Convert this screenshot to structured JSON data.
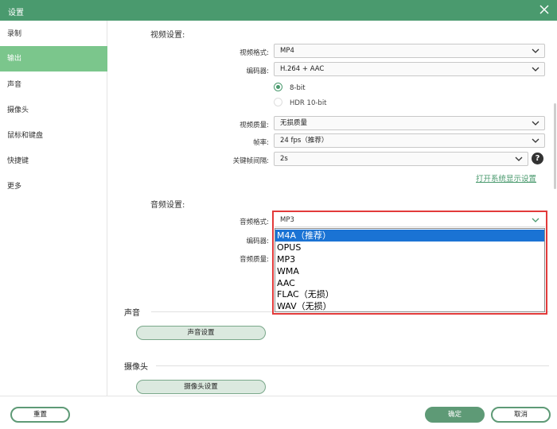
{
  "window": {
    "title": "设置",
    "close_icon": "close-icon"
  },
  "sidebar": {
    "items": [
      {
        "label": "录制",
        "active": false
      },
      {
        "label": "输出",
        "active": true
      },
      {
        "label": "声音",
        "active": false
      },
      {
        "label": "摄像头",
        "active": false
      },
      {
        "label": "鼠标和键盘",
        "active": false
      },
      {
        "label": "快捷键",
        "active": false
      },
      {
        "label": "更多",
        "active": false
      }
    ]
  },
  "video": {
    "section_title": "视频设置:",
    "format_label": "视频格式:",
    "format_value": "MP4",
    "encoder_label": "编码器:",
    "encoder_value": "H.264 + AAC",
    "radio_8bit": "8-bit",
    "radio_hdr": "HDR 10-bit",
    "quality_label": "视频质量:",
    "quality_value": "无损质量",
    "fps_label": "帧率:",
    "fps_value": "24 fps（推荐）",
    "keyframe_label": "关键帧间隔:",
    "keyframe_value": "2s",
    "help_glyph": "?",
    "display_link": "打开系统显示设置"
  },
  "audio": {
    "section_title": "音频设置:",
    "format_label": "音频格式:",
    "format_value": "MP3",
    "encoder_label": "编码器:",
    "quality_label": "音频质量:",
    "options": [
      "M4A（推荐）",
      "OPUS",
      "MP3",
      "WMA",
      "AAC",
      "FLAC（无损）",
      "WAV（无损）"
    ],
    "highlighted_option": "M4A（推荐）"
  },
  "sound": {
    "title": "声音",
    "button": "声音设置"
  },
  "camera": {
    "title": "摄像头",
    "button": "摄像头设置"
  },
  "footer": {
    "reset": "重置",
    "ok": "确定",
    "cancel": "取消"
  },
  "colors": {
    "accent": "#4a9a6e",
    "active_nav": "#7bc68c",
    "selection": "#1a73d4",
    "highlight_frame": "#e23a3a"
  }
}
